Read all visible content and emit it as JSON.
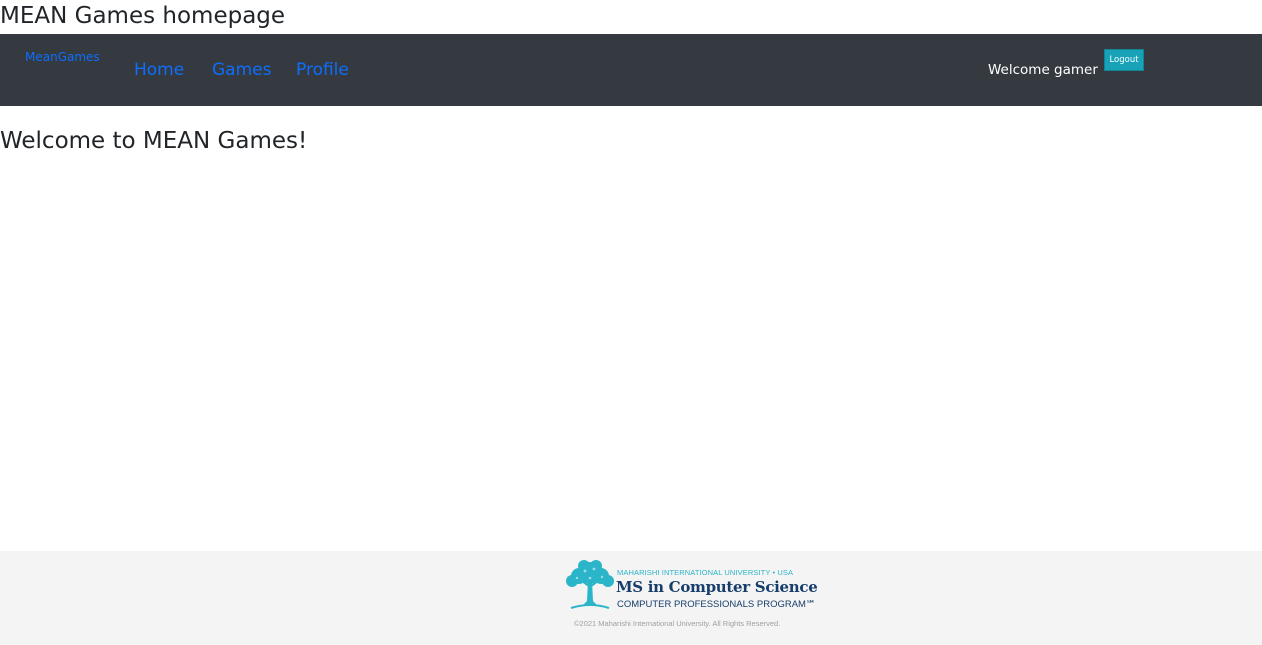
{
  "page": {
    "heading": "MEAN Games homepage"
  },
  "navbar": {
    "brand": "MeanGames",
    "links": [
      {
        "label": "Home"
      },
      {
        "label": "Games"
      },
      {
        "label": "Profile"
      }
    ],
    "welcome_text": "Welcome gamer",
    "logout_label": "Logout",
    "colors": {
      "background": "#343a40",
      "link": "#0d6efd",
      "logout_button": "#17a2b8"
    }
  },
  "main": {
    "heading": "Welcome to MEAN Games!"
  },
  "footer": {
    "logo": {
      "icon": "tree-icon",
      "university_line": "MAHARISHI INTERNATIONAL UNIVERSITY • USA",
      "program_line": "MS in Computer Science",
      "subprogram_line": "COMPUTER PROFESSIONALS PROGRAM℠"
    },
    "copyright": "©2021 Maharishi International University. All Rights Reserved.",
    "colors": {
      "background": "#f4f4f4",
      "logo_teal": "#2ab5c9",
      "logo_navy": "#173e6b"
    }
  }
}
